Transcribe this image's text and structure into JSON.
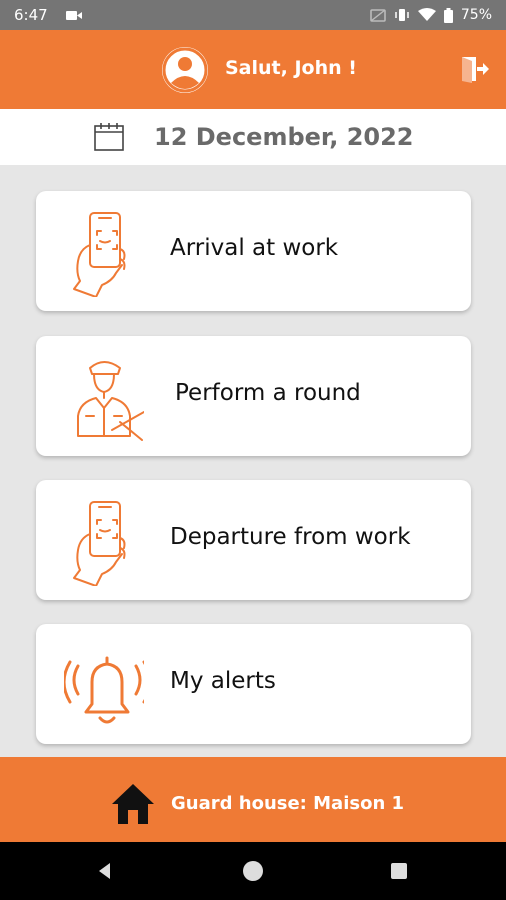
{
  "status_bar": {
    "time": "6:47",
    "battery": "75%",
    "icons": [
      "video-icon",
      "cast-icon",
      "vibrate-icon",
      "wifi-icon",
      "battery-icon"
    ]
  },
  "header": {
    "greeting": "Salut, John !",
    "avatar_icon": "user-avatar-icon",
    "logout_icon": "logout-icon",
    "background": "#ef7a35"
  },
  "date_bar": {
    "date": "12 December, 2022",
    "icon": "calendar-icon"
  },
  "menu": [
    {
      "label": "Arrival at work",
      "icon": "hand-phone-icon"
    },
    {
      "label": "Perform a round",
      "icon": "guard-icon"
    },
    {
      "label": "Departure from work",
      "icon": "hand-phone-icon"
    },
    {
      "label": "My alerts",
      "icon": "alarm-bell-icon"
    }
  ],
  "footer": {
    "guard_house": "Guard house: Maison 1",
    "icon": "house-icon"
  },
  "nav_bar": {
    "buttons": [
      "back-icon",
      "home-circle-icon",
      "recents-icon"
    ]
  },
  "colors": {
    "accent": "#ef7a35",
    "background": "#e6e6e6",
    "date_text": "#6a6a6a"
  }
}
